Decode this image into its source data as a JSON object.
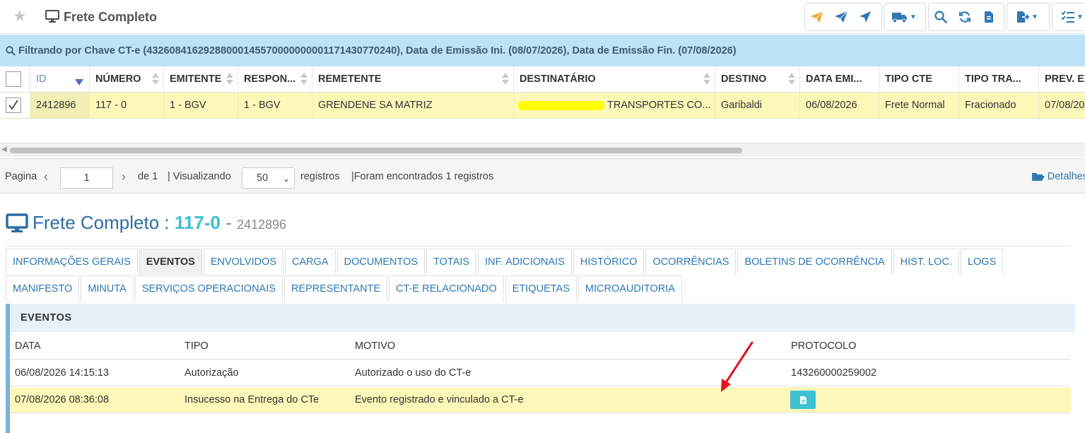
{
  "app": {
    "title": "Frete Completo"
  },
  "filter": {
    "text": "Filtrando por Chave CT-e (43260841629288000145570000000001171430770240), Data de Emissão Ini. (08/07/2026), Data de Emissão Fin. (07/08/2026)"
  },
  "colors": {
    "accent": "#2f78b5",
    "filterbar": "#bde3f6",
    "highlight": "#fdf8b9",
    "cyan": "#3dbfd0"
  },
  "grid": {
    "headers": [
      "ID",
      "NÚMERO",
      "EMITENTE",
      "RESPON...",
      "REMETENTE",
      "DESTINATÁRIO",
      "DESTINO",
      "DATA EMI...",
      "TIPO CTE",
      "TIPO TRA...",
      "PREV. EN"
    ],
    "row": {
      "id": "2412896",
      "numero": "117 - 0",
      "emitente": "1 - BGV",
      "responsavel": "1 - BGV",
      "remetente": "GRENDENE SA MATRIZ",
      "destinatario": "TRANSPORTES CO...",
      "destino": "Garibaldi",
      "data_emissao": "06/08/2026",
      "tipo_cte": "Frete Normal",
      "tipo_transporte": "Fracionado",
      "prev_entrega": "07/08/20"
    }
  },
  "pager": {
    "pagina_label": "Pagina",
    "page": "1",
    "de": "de 1",
    "visualizando": "| Visualizando",
    "per_page": "50",
    "registros": "registros",
    "found": "|Foram encontrados 1 registros",
    "detalhes": "Detalhes"
  },
  "detail": {
    "title": "Frete Completo :",
    "number": "117-0",
    "sep": "-",
    "id": "2412896",
    "tabs_row1": [
      "INFORMAÇÕES GERAIS",
      "EVENTOS",
      "ENVOLVIDOS",
      "CARGA",
      "DOCUMENTOS",
      "TOTAIS",
      "INF. ADICIONAIS",
      "HISTÓRICO",
      "OCORRÊNCIAS",
      "BOLETINS DE OCORRÊNCIA",
      "HIST. LOC.",
      "LOGS"
    ],
    "tabs_row2": [
      "MANIFESTO",
      "MINUTA",
      "SERVIÇOS OPERACIONAIS",
      "REPRESENTANTE",
      "CT-E RELACIONADO",
      "ETIQUETAS",
      "MICROAUDITORIA"
    ],
    "active_tab": "EVENTOS"
  },
  "eventos": {
    "heading": "EVENTOS",
    "columns": [
      "DATA",
      "TIPO",
      "MOTIVO",
      "PROTOCOLO"
    ],
    "rows": [
      {
        "data": "06/08/2026 14:15:13",
        "tipo": "Autorização",
        "motivo": "Autorizado o uso do CT-e",
        "protocolo": "143260000259002"
      },
      {
        "data": "07/08/2026 08:36:08",
        "tipo": "Insucesso na Entrega do CTe",
        "motivo": "Evento registrado e vinculado a CT-e",
        "protocolo": ""
      }
    ]
  },
  "icons": [
    "star-icon",
    "monitor-icon",
    "send-icon",
    "truck-icon",
    "search-icon",
    "refresh-icon",
    "document-icon",
    "export-icon",
    "checklist-icon",
    "folder-open-icon",
    "arrow-annotation"
  ]
}
